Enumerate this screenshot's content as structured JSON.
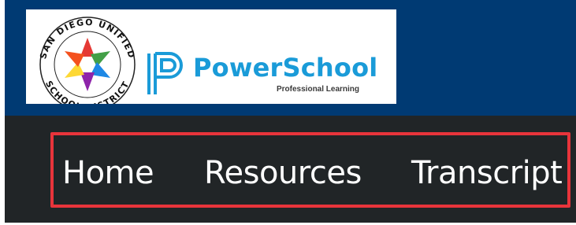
{
  "header": {
    "district_logo": {
      "ring_text": "SAN DIEGO UNIFIED · SCHOOL DISTRICT ·",
      "icon": "district-seal-icon",
      "star_colors": [
        "#e53935",
        "#43a047",
        "#1e88e5",
        "#8e24aa",
        "#f4511e",
        "#fdd835"
      ]
    },
    "brand": {
      "icon": "powerschool-mark-icon",
      "name": "PowerSchool",
      "tagline": "Professional Learning",
      "color": "#1a9bd8"
    }
  },
  "nav": {
    "items": [
      {
        "label": "Home"
      },
      {
        "label": "Resources"
      },
      {
        "label": "Transcript"
      }
    ],
    "highlight_color": "#e8343b"
  },
  "colors": {
    "header_bg": "#003a73",
    "nav_bg": "#212527"
  }
}
